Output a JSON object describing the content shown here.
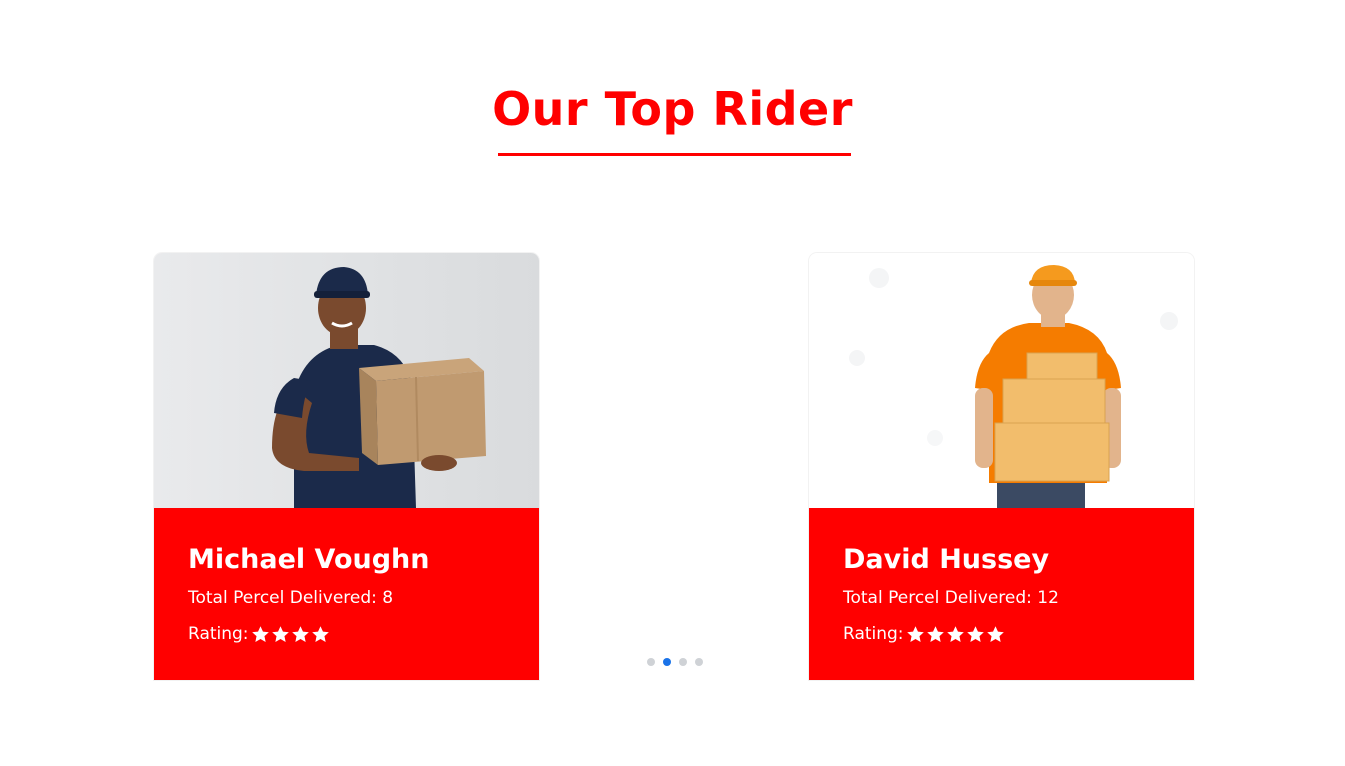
{
  "section": {
    "title": "Our Top Rider"
  },
  "riders": [
    {
      "name": "Michael Voughn",
      "delivered_text": "Total Percel Delivered: 8",
      "rating_label": "Rating:",
      "stars": 4,
      "photo_icon": "delivery-man-navy-polo-with-box"
    },
    {
      "name": "David Hussey",
      "delivered_text": "Total Percel Delivered: 12",
      "rating_label": "Rating:",
      "stars": 5,
      "photo_icon": "delivery-man-orange-cap-with-boxes"
    }
  ],
  "carousel": {
    "dot_count": 4,
    "active_index": 1
  },
  "colors": {
    "accent": "#ff0000",
    "active_dot": "#1a73e8",
    "inactive_dot": "#cfd2d6"
  }
}
